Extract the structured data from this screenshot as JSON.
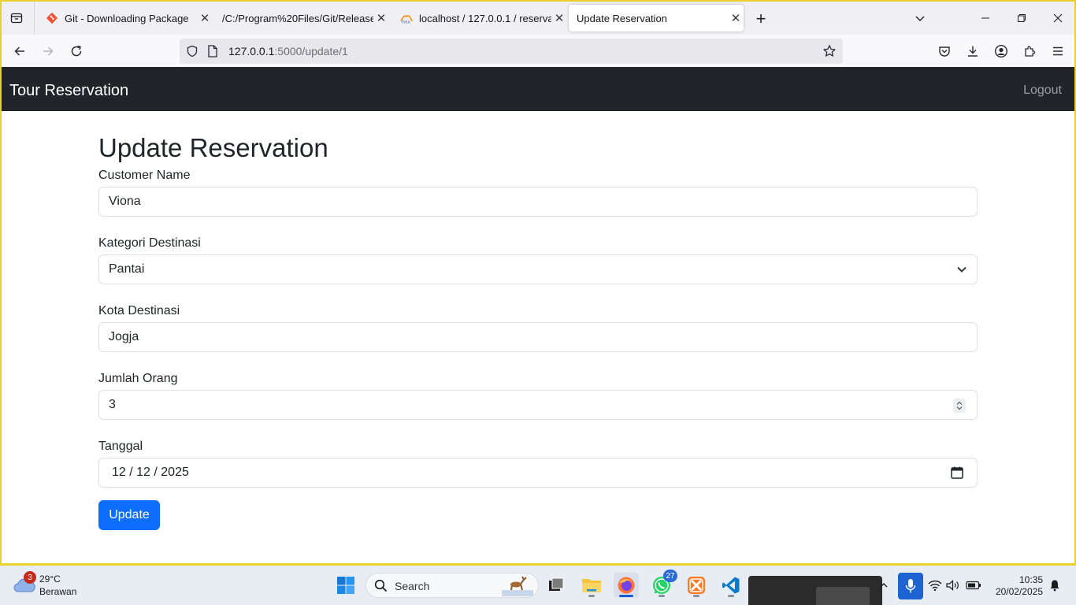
{
  "browser": {
    "tabs": [
      {
        "label": "Git - Downloading Package",
        "icon": "git-icon",
        "active": false
      },
      {
        "label": "/C:/Program%20Files/Git/ReleaseNotes",
        "icon": "none",
        "active": false
      },
      {
        "label": "localhost / 127.0.0.1 / reservasi_",
        "icon": "phpmyadmin-icon",
        "active": false
      },
      {
        "label": "Update Reservation",
        "icon": "none",
        "active": true
      }
    ],
    "url_host": "127.0.0.1",
    "url_path": ":5000/update/1"
  },
  "app": {
    "brand": "Tour Reservation",
    "logout": "Logout",
    "page_title": "Update Reservation",
    "form": {
      "customer_name_label": "Customer Name",
      "customer_name_value": "Viona",
      "kategori_label": "Kategori Destinasi",
      "kategori_value": "Pantai",
      "kota_label": "Kota Destinasi",
      "kota_value": "Jogja",
      "jumlah_label": "Jumlah Orang",
      "jumlah_value": "3",
      "tanggal_label": "Tanggal",
      "tanggal_value": "12 / 12 / 2025",
      "submit_label": "Update"
    },
    "colors": {
      "navbar": "#212529",
      "primary": "#0d6efd"
    }
  },
  "taskbar": {
    "weather_temp": "29°C",
    "weather_desc": "Berawan",
    "weather_badge": "3",
    "search_placeholder": "Search",
    "whatsapp_badge": "27",
    "time": "10:35",
    "date": "20/02/2025"
  }
}
